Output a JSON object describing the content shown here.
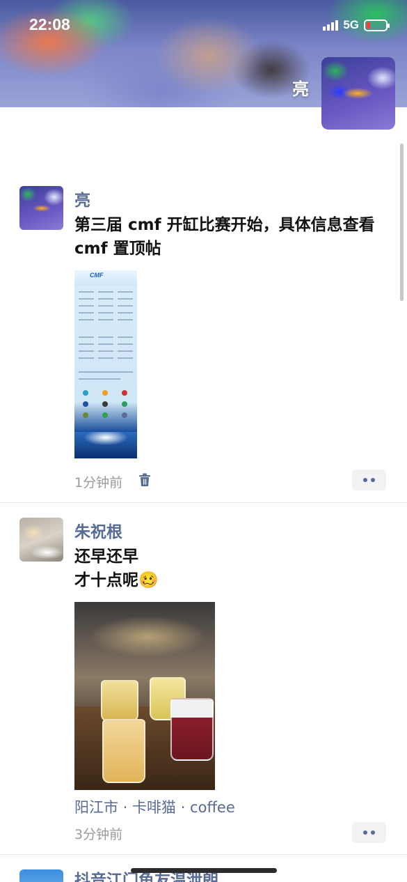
{
  "status_bar": {
    "time": "22:08",
    "network": "5G",
    "battery_color": "#ff3b30"
  },
  "profile": {
    "name": "亮"
  },
  "posts": [
    {
      "author": "亮",
      "text": "第三届 cmf 开缸比赛开始，具体信息查看 cmf 置顶帖",
      "image_caption": "CMF",
      "time": "1分钟前",
      "icons": [
        "trash-icon",
        "more-icon"
      ]
    },
    {
      "author": "朱祝根",
      "text_line1": "还早还早",
      "text_line2": "才十点呢",
      "emoji": "🥴",
      "location": "阳江市 · 卡啡猫 · coffee",
      "time": "3分钟前",
      "icons": [
        "more-icon"
      ]
    },
    {
      "author": "抖音江门鱼友温泄朗"
    }
  ],
  "colors": {
    "name_link": "#576b95",
    "timestamp": "#9a9a9a"
  }
}
